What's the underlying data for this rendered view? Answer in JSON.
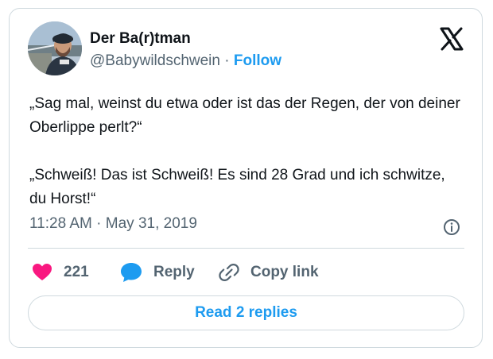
{
  "author": {
    "display_name": "Der Ba(r)tman",
    "handle": "@Babywildschwein",
    "separator": "·",
    "follow_label": "Follow"
  },
  "tweet": {
    "text": "„Sag mal, weinst du etwa oder ist das der Regen, der von deiner Oberlippe perlt?“\n\n„Schweiß! Das ist Schweiß! Es sind 28 Grad und ich schwitze, du Horst!“",
    "time": "11:28 AM",
    "separator": "·",
    "date": "May 31, 2019"
  },
  "actions": {
    "like_count": "221",
    "reply_label": "Reply",
    "copy_link_label": "Copy link"
  },
  "read_replies_label": "Read 2 replies",
  "colors": {
    "like": "#f91880",
    "reply": "#1d9bf0",
    "accent": "#1d9bf0",
    "muted": "#536471",
    "border": "#cfd9de"
  },
  "icons": [
    "x-logo-icon",
    "info-icon",
    "heart-icon",
    "reply-bubble-icon",
    "link-icon"
  ]
}
